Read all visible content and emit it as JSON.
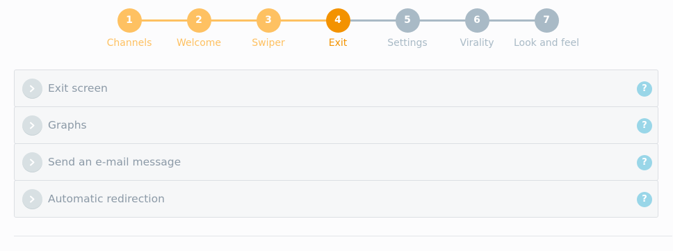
{
  "wizard": {
    "steps": [
      {
        "number": "1",
        "label": "Channels",
        "state": "done"
      },
      {
        "number": "2",
        "label": "Welcome",
        "state": "done"
      },
      {
        "number": "3",
        "label": "Swiper",
        "state": "done"
      },
      {
        "number": "4",
        "label": "Exit",
        "state": "active"
      },
      {
        "number": "5",
        "label": "Settings",
        "state": "todo"
      },
      {
        "number": "6",
        "label": "Virality",
        "state": "todo"
      },
      {
        "number": "7",
        "label": "Look and feel",
        "state": "todo"
      }
    ],
    "current_step": 4,
    "colors": {
      "done": "#fec162",
      "active": "#f39200",
      "todo": "#a9bac6"
    }
  },
  "panels": [
    {
      "title": "Exit screen",
      "help": "?",
      "expanded": false
    },
    {
      "title": "Graphs",
      "help": "?",
      "expanded": false
    },
    {
      "title": "Send an e-mail message",
      "help": "?",
      "expanded": false
    },
    {
      "title": "Automatic redirection",
      "help": "?",
      "expanded": false
    }
  ],
  "icons": {
    "panel_toggle": "chevron-right-icon",
    "panel_help": "question-mark-icon"
  },
  "colors": {
    "help_icon": "#99d6e8",
    "panel_text": "#8c9aa7"
  }
}
